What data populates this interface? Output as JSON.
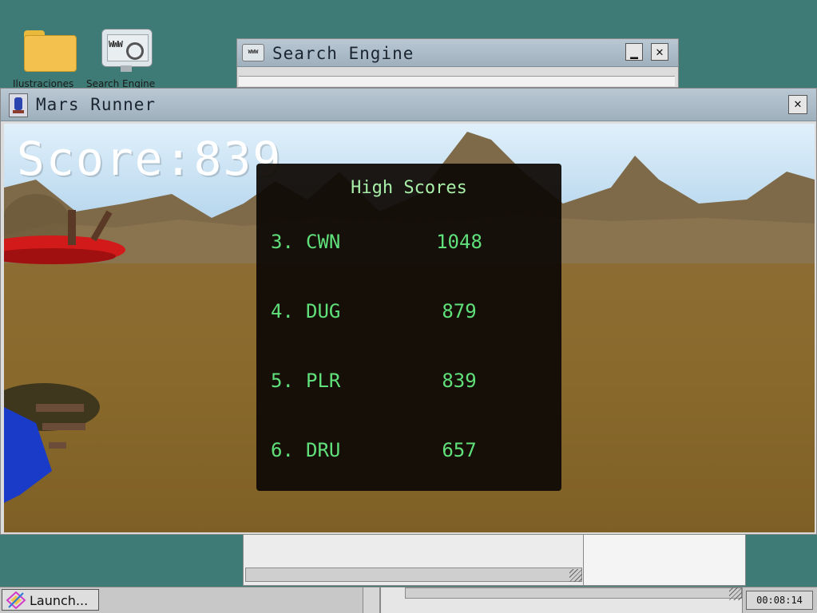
{
  "desktop": {
    "icons": [
      {
        "name": "folder-icon",
        "label": "Ilustraciones"
      },
      {
        "name": "search-engine-desktop-icon",
        "label": "Search Engine"
      }
    ]
  },
  "search_window": {
    "title": "Search Engine",
    "minimize_glyph": "▁",
    "close_glyph": "✕"
  },
  "mars_window": {
    "title": "Mars Runner",
    "close_glyph": "✕"
  },
  "game": {
    "score_label": "Score:",
    "score_value": "839",
    "high_scores": {
      "title": "High Scores",
      "rows": [
        {
          "rank": "3.",
          "name": "CWN",
          "score": "1048"
        },
        {
          "rank": "4.",
          "name": "DUG",
          "score": "879"
        },
        {
          "rank": "5.",
          "name": "PLR",
          "score": "839"
        },
        {
          "rank": "6.",
          "name": "DRU",
          "score": "657"
        }
      ]
    }
  },
  "taskbar": {
    "launch_label": "Launch...",
    "clock": "00:08:14"
  },
  "colors": {
    "desktop_bg": "#3f7b76",
    "titlebar": "#a9b9c5",
    "high_score_text": "#5fe07a",
    "mars_ground": "#8a6a2c"
  }
}
